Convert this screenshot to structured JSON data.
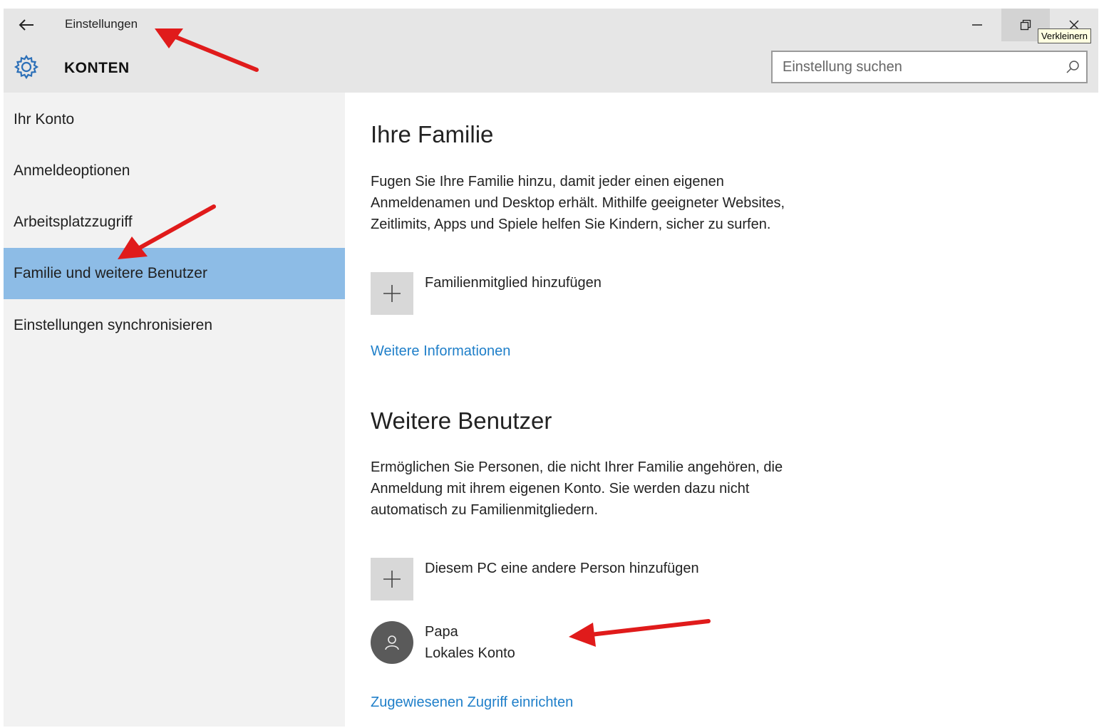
{
  "window": {
    "title": "Einstellungen",
    "section": "KONTEN",
    "tooltip": "Verkleinern"
  },
  "search": {
    "placeholder": "Einstellung suchen"
  },
  "sidebar": {
    "items": [
      {
        "label": "Ihr Konto"
      },
      {
        "label": "Anmeldeoptionen"
      },
      {
        "label": "Arbeitsplatzzugriff"
      },
      {
        "label": "Familie und weitere Benutzer"
      },
      {
        "label": "Einstellungen synchronisieren"
      }
    ]
  },
  "family": {
    "heading": "Ihre Familie",
    "description_lines": [
      "Fugen Sie Ihre Familie hinzu, damit jeder einen eigenen",
      "Anmeldenamen und Desktop erhält. Mithilfe geeigneter Websites,",
      "Zeitlimits, Apps und Spiele helfen Sie Kindern, sicher zu surfen."
    ],
    "add_label": "Familienmitglied hinzufügen",
    "more_info_link": "Weitere Informationen"
  },
  "others": {
    "heading": "Weitere Benutzer",
    "description_lines": [
      "Ermöglichen Sie Personen, die nicht Ihrer Familie angehören, die",
      "Anmeldung mit ihrem eigenen Konto. Sie werden dazu nicht",
      "automatisch zu Familienmitgliedern."
    ],
    "add_label": "Diesem PC eine andere Person hinzufügen",
    "user": {
      "name": "Papa",
      "type": "Lokales Konto"
    },
    "assigned_access_link": "Zugewiesenen Zugriff einrichten"
  },
  "colors": {
    "header_bg": "#e6e6e6",
    "sidebar_bg": "#f2f2f2",
    "selected_bg": "#8dbce6",
    "link": "#1f7fc9",
    "annotation_arrow": "#e01b1b"
  },
  "icons": {
    "back": "back-arrow-icon",
    "settings": "gear-icon",
    "search": "search-icon",
    "minimize": "minimize-icon",
    "restore": "restore-icon",
    "close": "close-icon",
    "add": "plus-icon",
    "user": "user-icon"
  }
}
